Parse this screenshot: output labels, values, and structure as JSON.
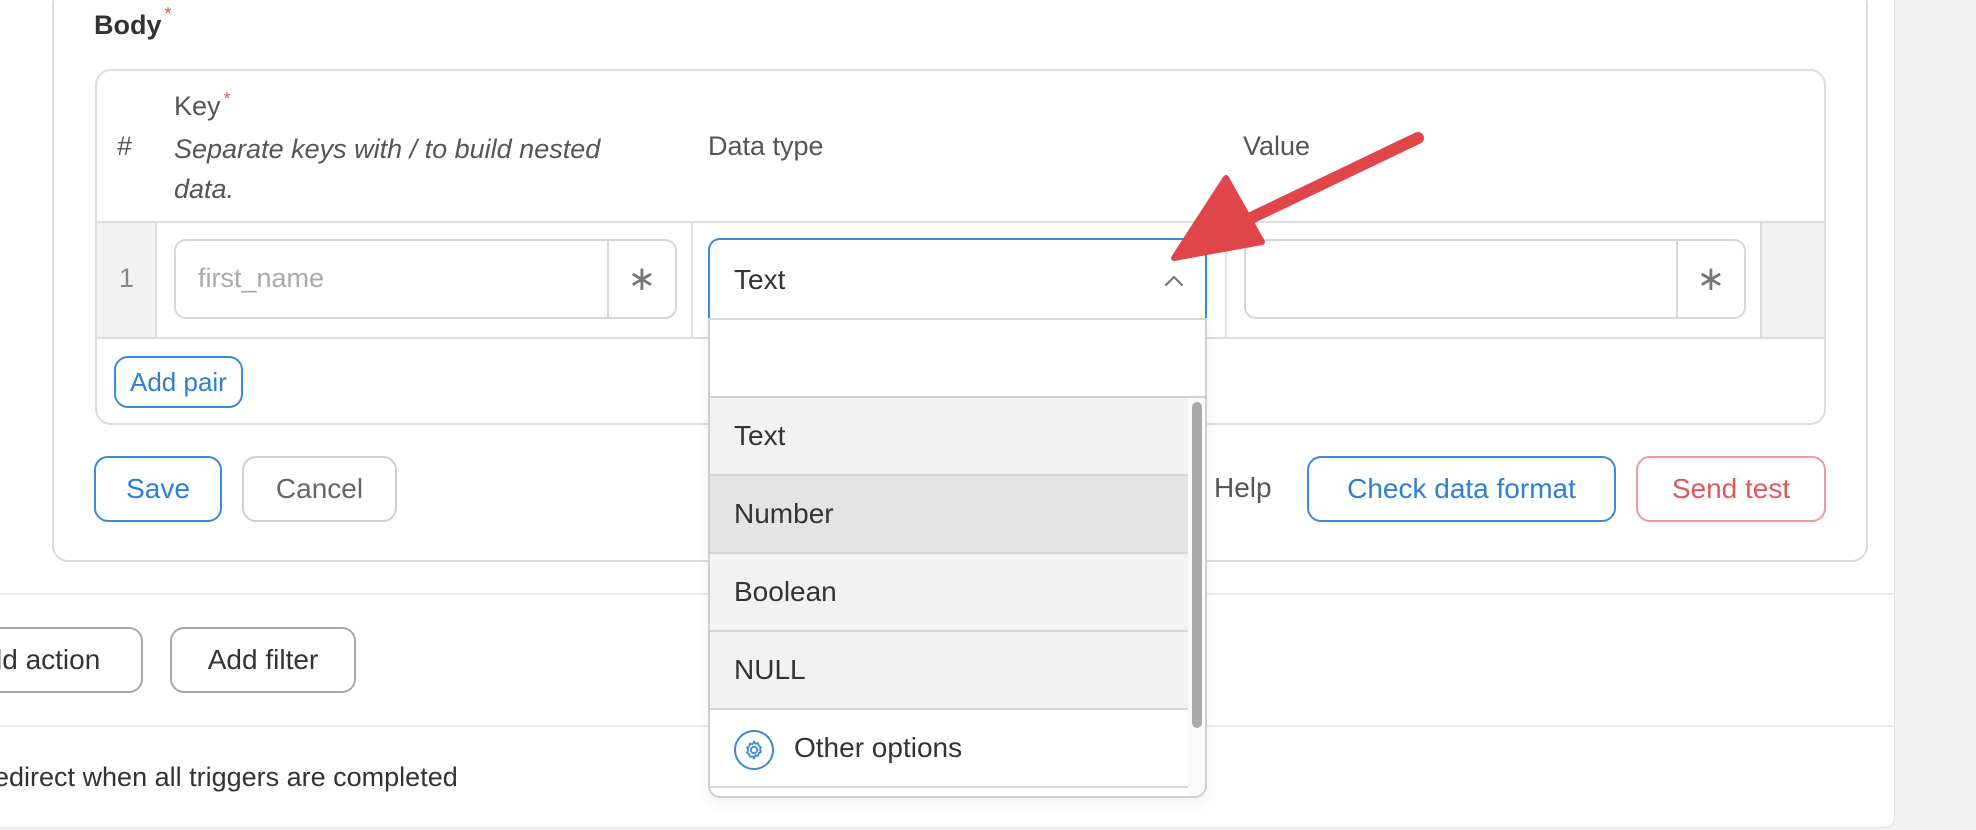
{
  "body_section": {
    "label": "Body",
    "required_mark": "*"
  },
  "table": {
    "headers": {
      "index": "#",
      "key": "Key",
      "key_required": "*",
      "key_hint": "Separate keys with / to build nested data.",
      "data_type": "Data type",
      "value": "Value"
    },
    "rows": [
      {
        "index": "1",
        "key_placeholder": "first_name",
        "key_addon": "∗",
        "data_type": "Text",
        "value": "",
        "value_addon": "∗"
      }
    ],
    "add_pair_label": "Add pair"
  },
  "dropdown": {
    "search_value": "",
    "options": [
      "Text",
      "Number",
      "Boolean",
      "NULL"
    ],
    "hovered_option": "Number",
    "other_options_label": "Other options"
  },
  "actions": {
    "save_label": "Save",
    "cancel_label": "Cancel",
    "help_label": "Help",
    "check_format_label": "Check data format",
    "send_test_label": "Send test"
  },
  "footer": {
    "add_action_label": "ld action",
    "add_filter_label": "Add filter",
    "redirect_text": "edirect when all triggers are completed"
  },
  "colors": {
    "accent": "#2f7fd0",
    "danger": "#e05a5a",
    "annotation_arrow": "#e0454a"
  }
}
